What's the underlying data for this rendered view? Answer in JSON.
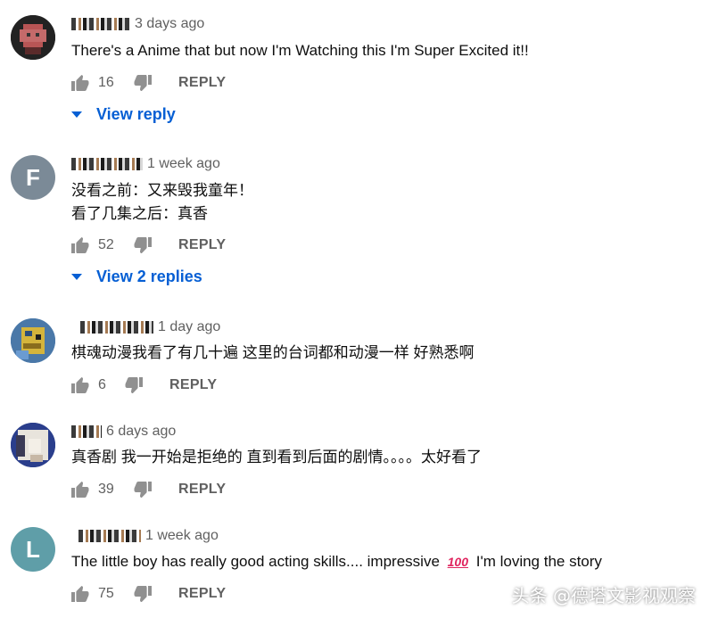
{
  "comments": [
    {
      "time": "3 days ago",
      "lines": [
        "There's a Anime that but now I'm Watching this I'm Super Excited it!!"
      ],
      "likes": "16",
      "reply_label": "REPLY",
      "view_replies": "View reply",
      "avatar_color": "#8b2b2b"
    },
    {
      "time": "1 week ago",
      "lines": [
        "没看之前：又来毁我童年！",
        "看了几集之后：真香"
      ],
      "likes": "52",
      "reply_label": "REPLY",
      "view_replies": "View 2 replies",
      "avatar_letter": "F",
      "avatar_color": "#7b8a97"
    },
    {
      "time": "1 day ago",
      "lines": [
        "棋魂动漫我看了有几十遍 这里的台词都和动漫一样 好熟悉啊"
      ],
      "likes": "6",
      "reply_label": "REPLY",
      "avatar_color": "#3b6fa8"
    },
    {
      "time": "6 days ago",
      "lines": [
        "真香剧 我一开始是拒绝的 直到看到后面的剧情。。。。太好看了"
      ],
      "likes": "39",
      "reply_label": "REPLY",
      "avatar_color": "#2a3e8c"
    },
    {
      "time": "1 week ago",
      "text_before": "The little boy has really good acting skills.... impressive",
      "emoji": "100",
      "text_after": "I'm loving the story",
      "likes": "75",
      "reply_label": "REPLY",
      "avatar_letter": "L",
      "avatar_color": "#5f9ea8"
    }
  ],
  "watermark": "头条 @德塔文影视观察",
  "colors": {
    "link": "#065fd4",
    "muted": "#606060"
  }
}
